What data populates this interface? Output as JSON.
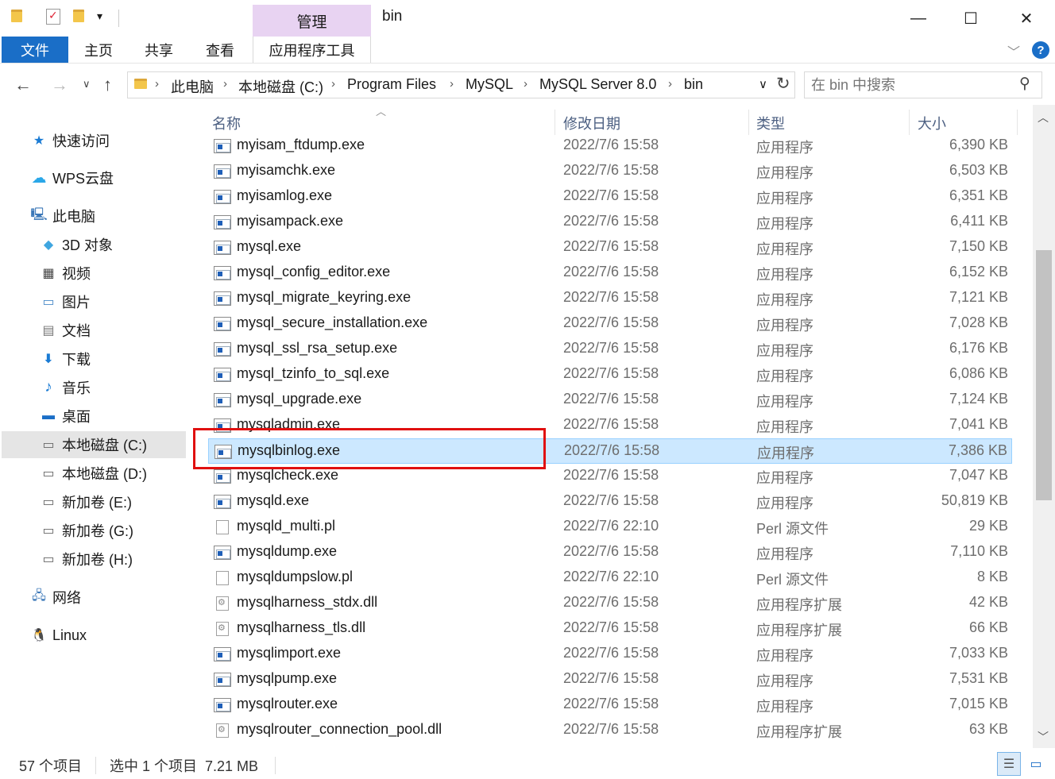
{
  "window": {
    "title": "bin",
    "manage_tab": "管理",
    "minimize_glyph": "—",
    "maximize_glyph": "☐",
    "close_glyph": "✕"
  },
  "ribbon": {
    "tabs": [
      {
        "label": "文件"
      },
      {
        "label": "主页"
      },
      {
        "label": "共享"
      },
      {
        "label": "查看"
      },
      {
        "label": "应用程序工具"
      }
    ],
    "help_glyph": "?"
  },
  "address": {
    "crumbs": [
      "此电脑",
      "本地磁盘 (C:)",
      "Program Files",
      "MySQL",
      "MySQL Server 8.0",
      "bin"
    ],
    "separator": "›"
  },
  "search": {
    "placeholder": "在 bin 中搜索"
  },
  "nav_pane": {
    "items": [
      {
        "label": "快速访问",
        "icon": "star-icon"
      },
      {
        "label": "WPS云盘",
        "icon": "cloud-icon"
      },
      {
        "label": "此电脑",
        "icon": "computer-icon"
      },
      {
        "label": "3D 对象",
        "icon": "cube-icon"
      },
      {
        "label": "视频",
        "icon": "film-icon"
      },
      {
        "label": "图片",
        "icon": "picture-icon"
      },
      {
        "label": "文档",
        "icon": "document-icon"
      },
      {
        "label": "下载",
        "icon": "download-icon"
      },
      {
        "label": "音乐",
        "icon": "music-icon"
      },
      {
        "label": "桌面",
        "icon": "desktop-icon"
      },
      {
        "label": "本地磁盘 (C:)",
        "icon": "drive-icon"
      },
      {
        "label": "本地磁盘 (D:)",
        "icon": "drive-icon"
      },
      {
        "label": "新加卷 (E:)",
        "icon": "drive-icon"
      },
      {
        "label": "新加卷 (G:)",
        "icon": "drive-icon"
      },
      {
        "label": "新加卷 (H:)",
        "icon": "drive-icon"
      },
      {
        "label": "网络",
        "icon": "network-icon"
      },
      {
        "label": "Linux",
        "icon": "linux-icon"
      }
    ]
  },
  "file_list": {
    "columns": {
      "name": "名称",
      "date": "修改日期",
      "type": "类型",
      "size": "大小"
    },
    "rows": [
      {
        "name": "myisam_ftdump.exe",
        "date": "2022/7/6 15:58",
        "type": "应用程序",
        "size": "6,390 KB",
        "kind": "exe"
      },
      {
        "name": "myisamchk.exe",
        "date": "2022/7/6 15:58",
        "type": "应用程序",
        "size": "6,503 KB",
        "kind": "exe"
      },
      {
        "name": "myisamlog.exe",
        "date": "2022/7/6 15:58",
        "type": "应用程序",
        "size": "6,351 KB",
        "kind": "exe"
      },
      {
        "name": "myisampack.exe",
        "date": "2022/7/6 15:58",
        "type": "应用程序",
        "size": "6,411 KB",
        "kind": "exe"
      },
      {
        "name": "mysql.exe",
        "date": "2022/7/6 15:58",
        "type": "应用程序",
        "size": "7,150 KB",
        "kind": "exe"
      },
      {
        "name": "mysql_config_editor.exe",
        "date": "2022/7/6 15:58",
        "type": "应用程序",
        "size": "6,152 KB",
        "kind": "exe"
      },
      {
        "name": "mysql_migrate_keyring.exe",
        "date": "2022/7/6 15:58",
        "type": "应用程序",
        "size": "7,121 KB",
        "kind": "exe"
      },
      {
        "name": "mysql_secure_installation.exe",
        "date": "2022/7/6 15:58",
        "type": "应用程序",
        "size": "7,028 KB",
        "kind": "exe"
      },
      {
        "name": "mysql_ssl_rsa_setup.exe",
        "date": "2022/7/6 15:58",
        "type": "应用程序",
        "size": "6,176 KB",
        "kind": "exe"
      },
      {
        "name": "mysql_tzinfo_to_sql.exe",
        "date": "2022/7/6 15:58",
        "type": "应用程序",
        "size": "6,086 KB",
        "kind": "exe"
      },
      {
        "name": "mysql_upgrade.exe",
        "date": "2022/7/6 15:58",
        "type": "应用程序",
        "size": "7,124 KB",
        "kind": "exe"
      },
      {
        "name": "mysqladmin.exe",
        "date": "2022/7/6 15:58",
        "type": "应用程序",
        "size": "7,041 KB",
        "kind": "exe"
      },
      {
        "name": "mysqlbinlog.exe",
        "date": "2022/7/6 15:58",
        "type": "应用程序",
        "size": "7,386 KB",
        "kind": "exe",
        "selected": true
      },
      {
        "name": "mysqlcheck.exe",
        "date": "2022/7/6 15:58",
        "type": "应用程序",
        "size": "7,047 KB",
        "kind": "exe"
      },
      {
        "name": "mysqld.exe",
        "date": "2022/7/6 15:58",
        "type": "应用程序",
        "size": "50,819 KB",
        "kind": "exe"
      },
      {
        "name": "mysqld_multi.pl",
        "date": "2022/7/6 22:10",
        "type": "Perl 源文件",
        "size": "29 KB",
        "kind": "pl"
      },
      {
        "name": "mysqldump.exe",
        "date": "2022/7/6 15:58",
        "type": "应用程序",
        "size": "7,110 KB",
        "kind": "exe"
      },
      {
        "name": "mysqldumpslow.pl",
        "date": "2022/7/6 22:10",
        "type": "Perl 源文件",
        "size": "8 KB",
        "kind": "pl"
      },
      {
        "name": "mysqlharness_stdx.dll",
        "date": "2022/7/6 15:58",
        "type": "应用程序扩展",
        "size": "42 KB",
        "kind": "dll"
      },
      {
        "name": "mysqlharness_tls.dll",
        "date": "2022/7/6 15:58",
        "type": "应用程序扩展",
        "size": "66 KB",
        "kind": "dll"
      },
      {
        "name": "mysqlimport.exe",
        "date": "2022/7/6 15:58",
        "type": "应用程序",
        "size": "7,033 KB",
        "kind": "exe"
      },
      {
        "name": "mysqlpump.exe",
        "date": "2022/7/6 15:58",
        "type": "应用程序",
        "size": "7,531 KB",
        "kind": "exe"
      },
      {
        "name": "mysqlrouter.exe",
        "date": "2022/7/6 15:58",
        "type": "应用程序",
        "size": "7,015 KB",
        "kind": "exe"
      },
      {
        "name": "mysqlrouter_connection_pool.dll",
        "date": "2022/7/6 15:58",
        "type": "应用程序扩展",
        "size": "63 KB",
        "kind": "dll"
      }
    ]
  },
  "scroll": {
    "position_fraction": 0.33,
    "visible_fraction": 0.42
  },
  "status": {
    "item_count": "57 个项目",
    "selection": "选中 1 个项目  7.21 MB"
  },
  "colors": {
    "accent": "#1a6ec7",
    "selection": "#cce8ff",
    "highlight_box": "#e01010",
    "manage_tab": "#e8d3f2"
  }
}
